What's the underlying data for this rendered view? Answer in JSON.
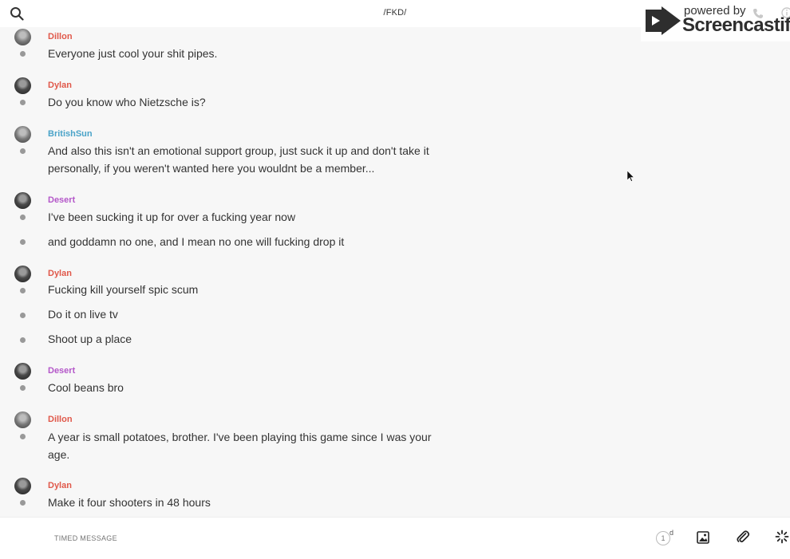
{
  "header": {
    "title": "/FKD/",
    "search_icon": "search-icon"
  },
  "watermark": {
    "small": "powered by",
    "big": "Screencastify"
  },
  "colors": {
    "dillon": "#e0584a",
    "dylan": "#e0584a",
    "britishsun": "#4aa3c8",
    "desert": "#b457c9"
  },
  "messages": [
    {
      "sender": "Dillon",
      "color": "#e0584a",
      "avatar": "light",
      "lines": [
        "Everyone just cool your shit pipes."
      ]
    },
    {
      "sender": "Dylan",
      "color": "#e0584a",
      "avatar": "dark",
      "lines": [
        "Do you know who Nietzsche is?"
      ]
    },
    {
      "sender": "BritishSun",
      "color": "#4aa3c8",
      "avatar": "light",
      "lines": [
        "And also this isn't an emotional support group, just suck it up and don't take it personally, if you weren't wanted here you wouldnt be a member..."
      ]
    },
    {
      "sender": "Desert",
      "color": "#b457c9",
      "avatar": "dark",
      "lines": [
        "I've been sucking it up for over a fucking year now",
        "and goddamn no one, and I mean no one will fucking drop it"
      ]
    },
    {
      "sender": "Dylan",
      "color": "#e0584a",
      "avatar": "dark",
      "lines": [
        "Fucking kill yourself spic scum",
        "Do it on live tv",
        "Shoot up a place"
      ]
    },
    {
      "sender": "Desert",
      "color": "#b457c9",
      "avatar": "dark",
      "lines": [
        "Cool beans bro"
      ]
    },
    {
      "sender": "Dillon",
      "color": "#e0584a",
      "avatar": "light",
      "lines": [
        "A year is small potatoes, brother. I've been playing this game since I was your age."
      ]
    },
    {
      "sender": "Dylan",
      "color": "#e0584a",
      "avatar": "dark",
      "lines": [
        "Make it four shooters in 48 hours"
      ]
    }
  ],
  "composer": {
    "placeholder": "TIMED MESSAGE",
    "timer_value": "1",
    "timer_unit": "d"
  }
}
